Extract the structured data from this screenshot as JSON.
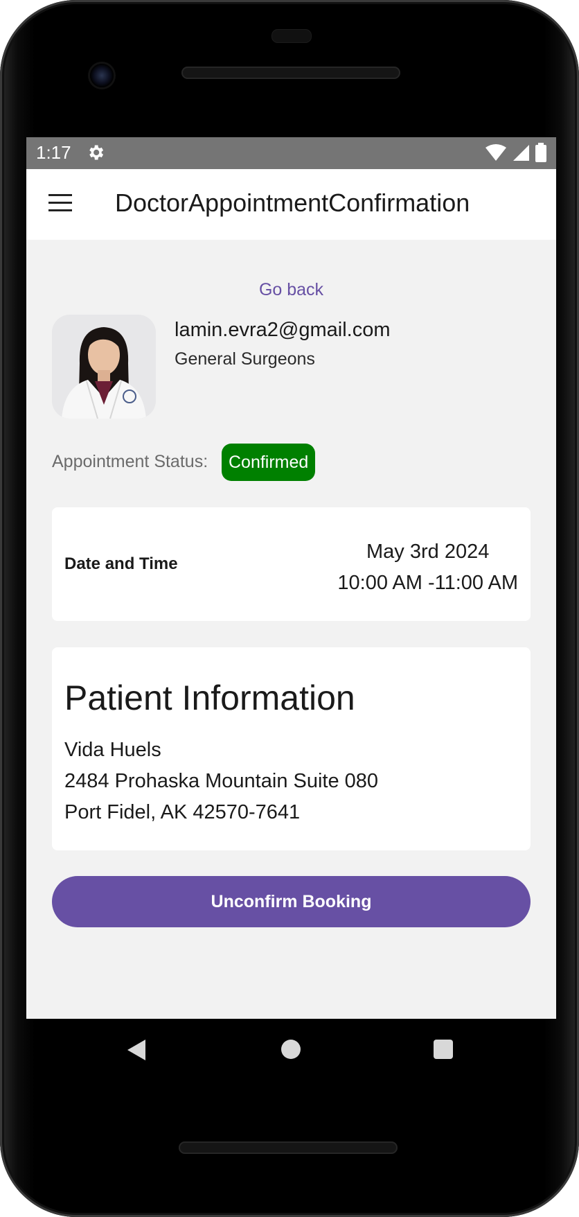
{
  "status_bar": {
    "time": "1:17",
    "icons": [
      "gear-icon",
      "wifi-icon",
      "signal-icon",
      "battery-icon"
    ]
  },
  "app_bar": {
    "title": "DoctorAppointmentConfirmation",
    "menu_icon": "menu-icon"
  },
  "main": {
    "go_back": "Go back",
    "doctor": {
      "email": "lamin.evra2@gmail.com",
      "specialty": "General Surgeons"
    },
    "appointment_status": {
      "label": "Appointment Status:",
      "value": "Confirmed",
      "color": "#008000"
    },
    "date_time": {
      "label": "Date and Time",
      "date": "May 3rd 2024",
      "time": "10:00 AM -11:00 AM"
    },
    "patient": {
      "title": "Patient Information",
      "name": "Vida Huels",
      "address_line1": "2484 Prohaska Mountain Suite 080",
      "address_line2": "Port Fidel, AK 42570-7641"
    },
    "action_button": "Unconfirm Booking",
    "accent_color": "#6750a4"
  },
  "nav_bar": {
    "icons": [
      "back-icon",
      "home-icon",
      "recents-icon"
    ]
  }
}
